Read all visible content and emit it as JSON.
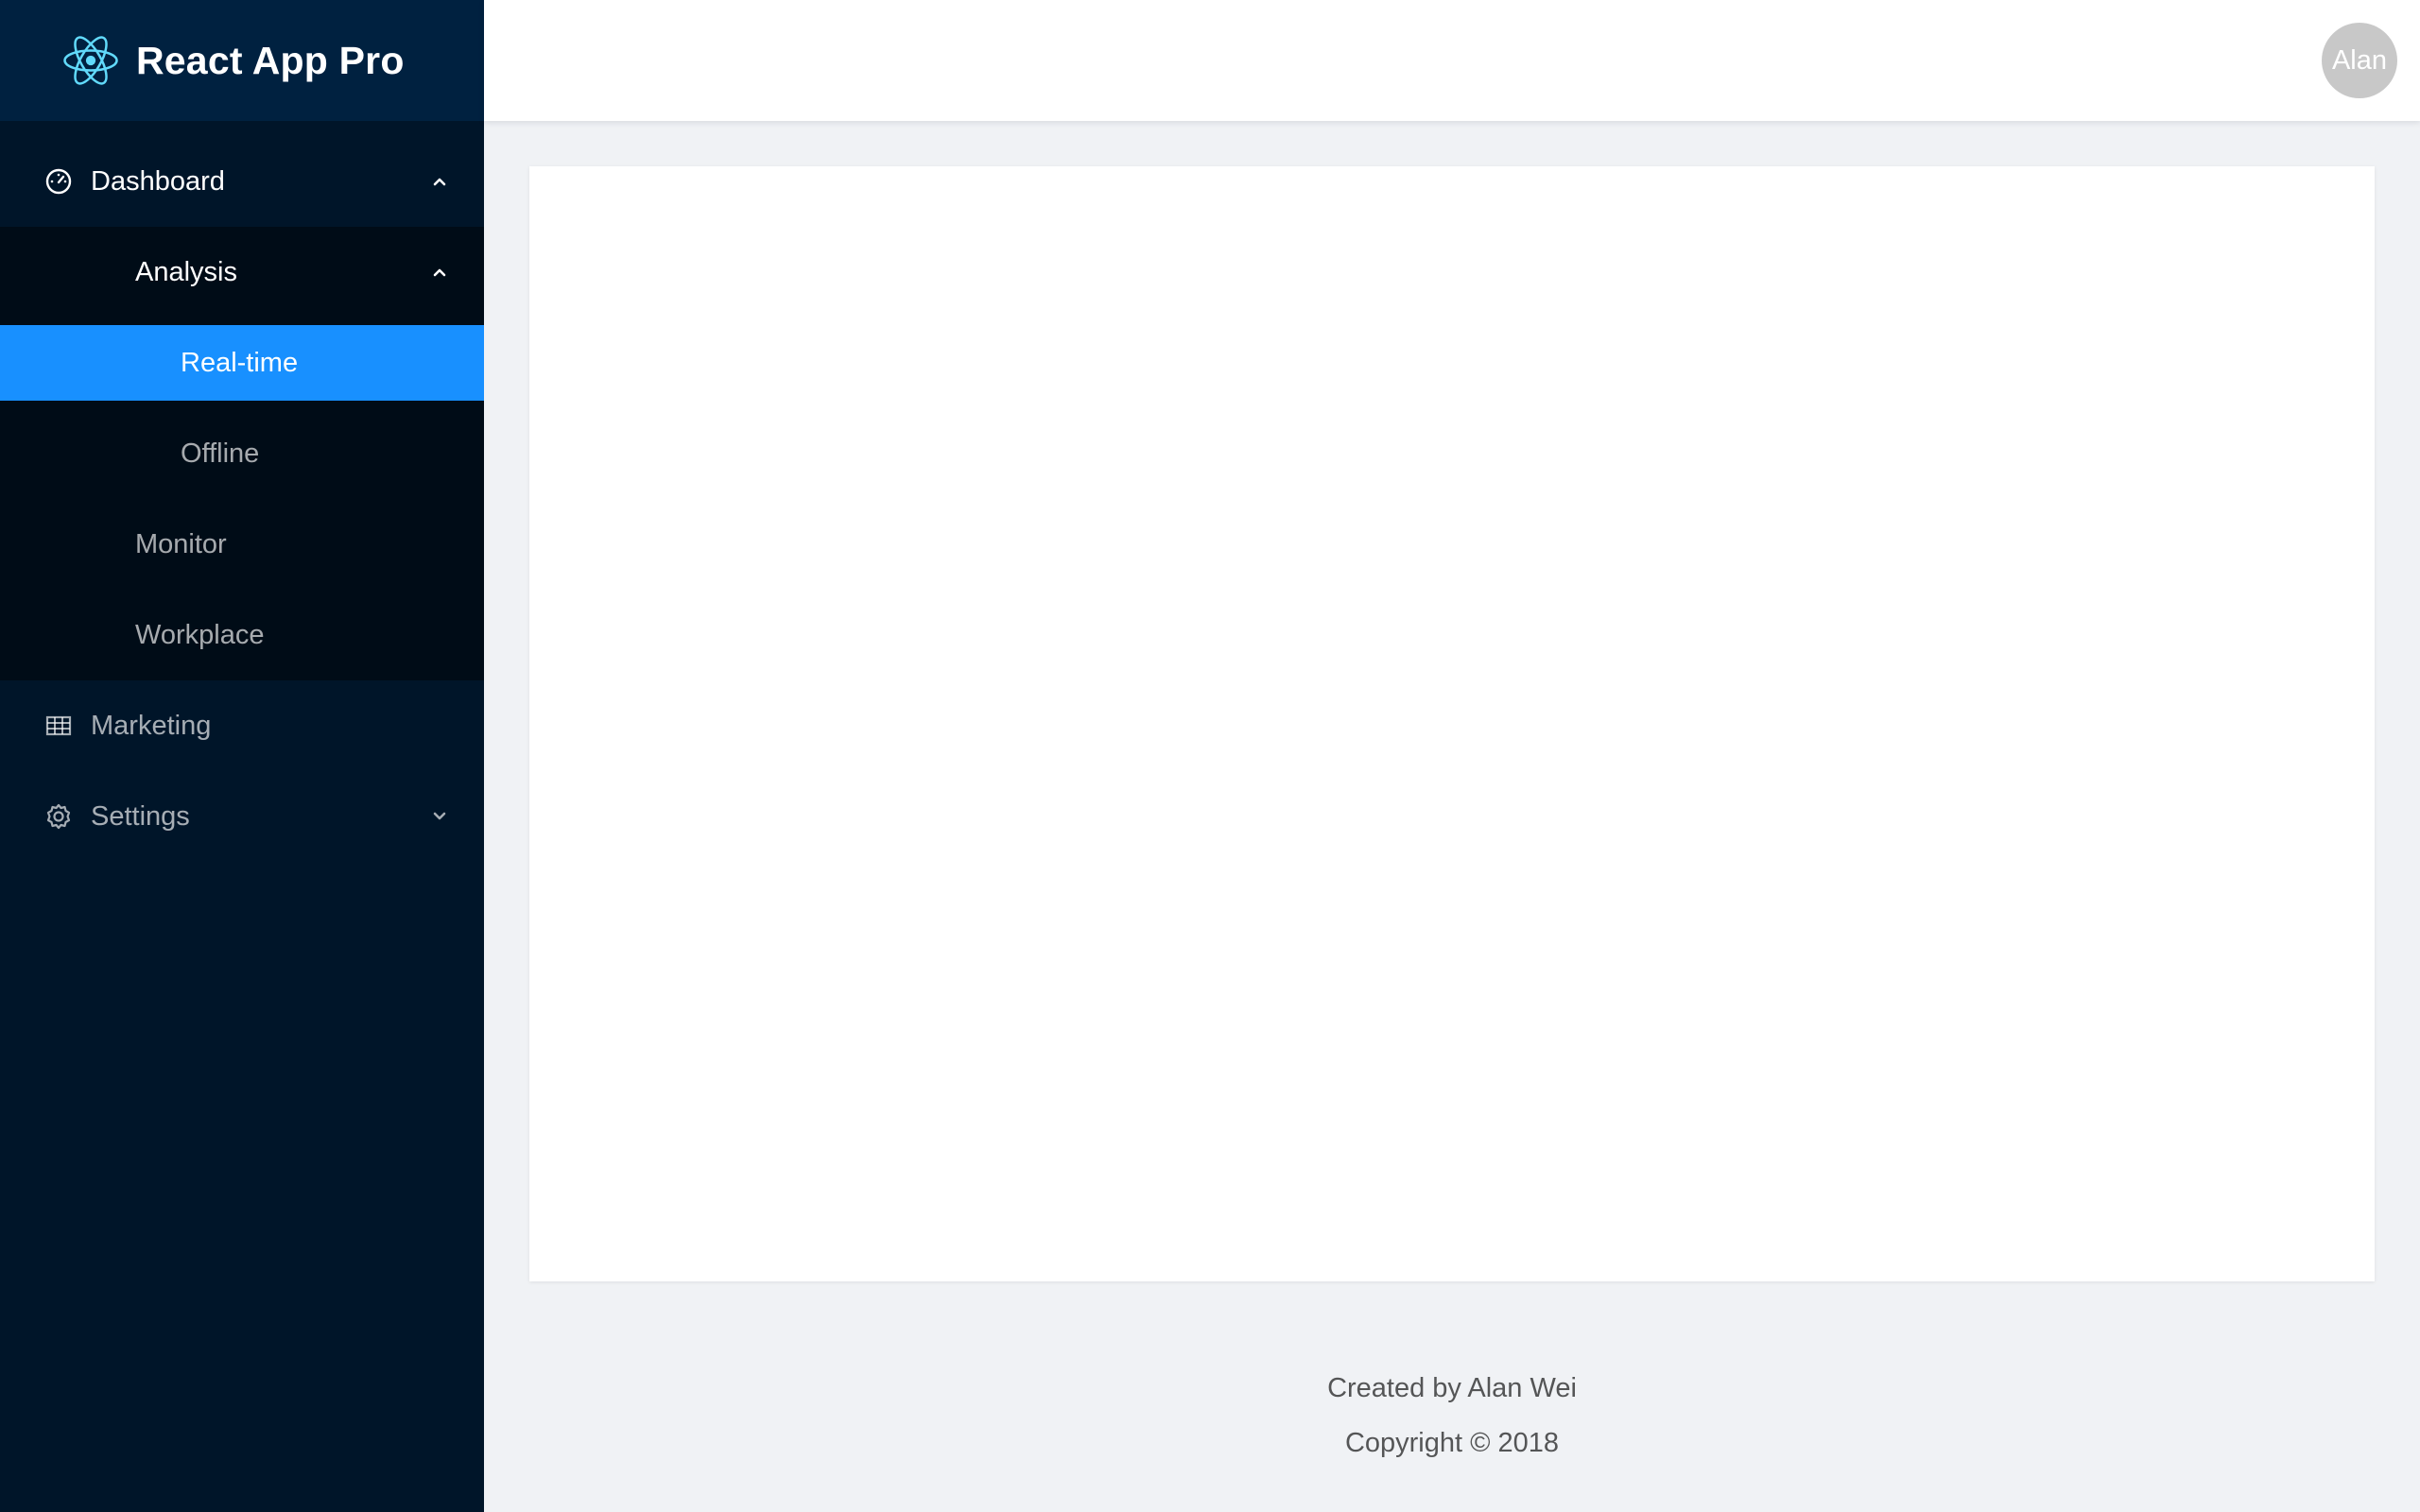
{
  "app": {
    "title": "React App Pro",
    "logo_icon": "react-atom-icon"
  },
  "colors": {
    "sidebar_bg": "#001529",
    "submenu_bg": "#000c17",
    "accent": "#1890ff",
    "logo": "#61dafb"
  },
  "sidebar": {
    "items": [
      {
        "label": "Dashboard",
        "icon": "dashboard-icon",
        "expanded": true
      },
      {
        "label": "Analysis",
        "expanded": true
      },
      {
        "label": "Real-time",
        "selected": true
      },
      {
        "label": "Offline"
      },
      {
        "label": "Monitor"
      },
      {
        "label": "Workplace"
      },
      {
        "label": "Marketing",
        "icon": "table-icon"
      },
      {
        "label": "Settings",
        "icon": "settings-icon",
        "expanded": false
      }
    ]
  },
  "header": {
    "avatar_text": "Alan"
  },
  "footer": {
    "created_by": "Created by Alan Wei",
    "copyright": "Copyright © 2018"
  }
}
